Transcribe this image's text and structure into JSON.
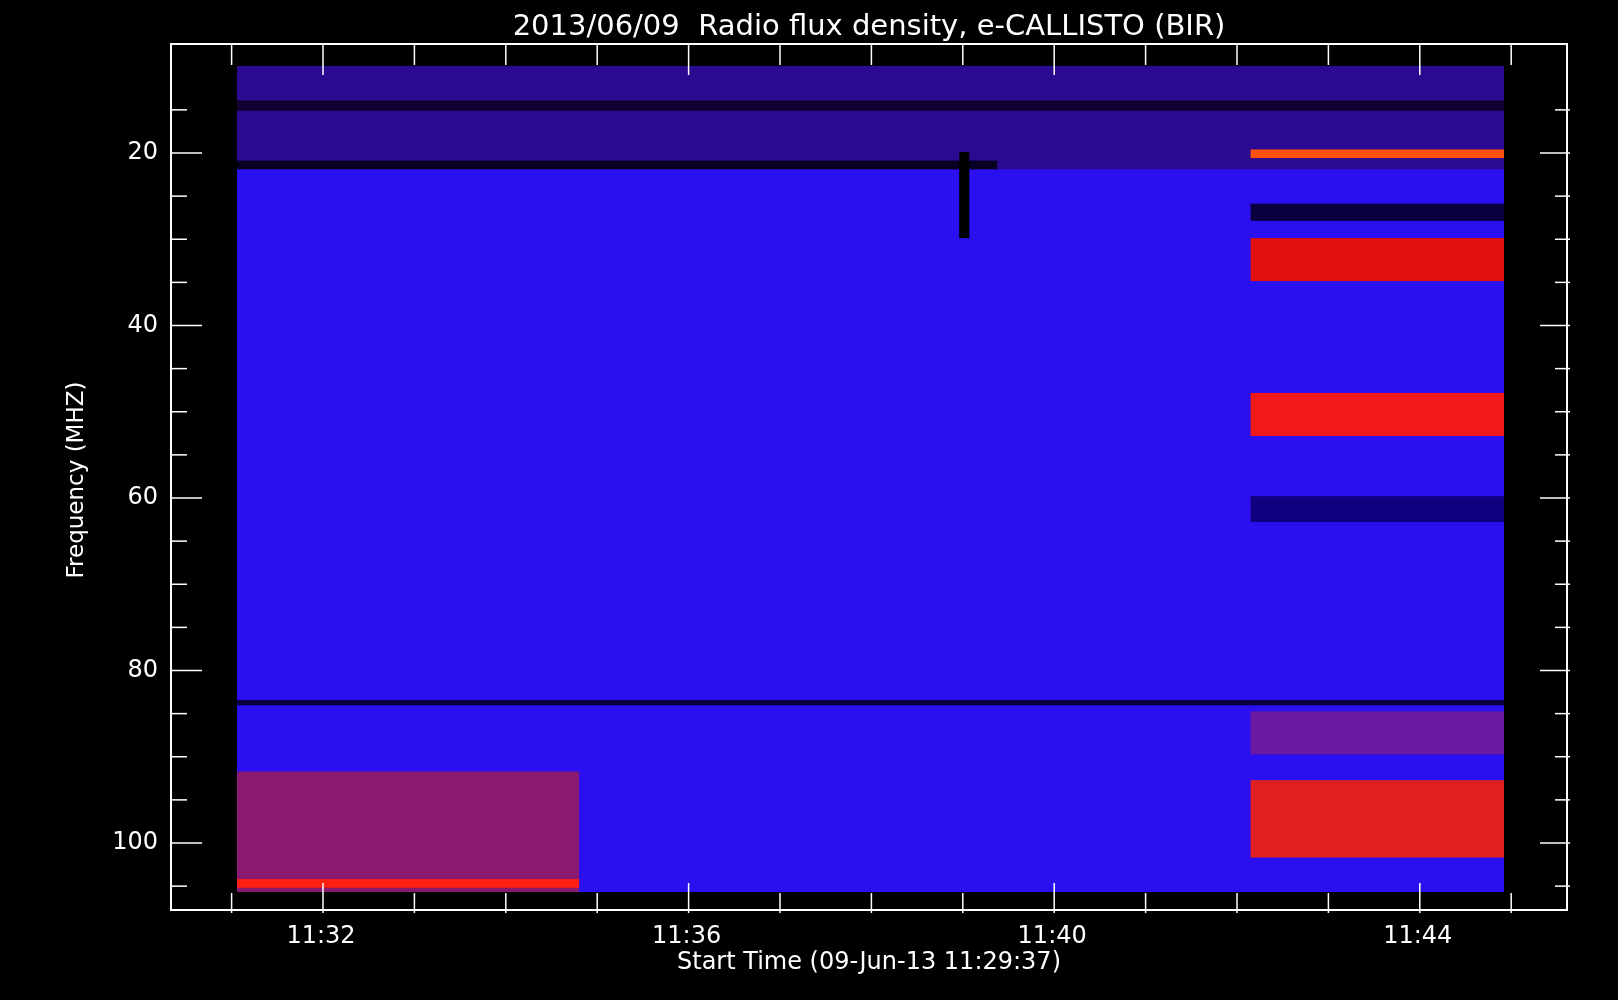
{
  "plot": {
    "title": "2013/06/09  Radio flux density, e-CALLISTO (BIR)",
    "ylabel": "Frequency (MHZ)",
    "xlabel": "Start Time (09-Jun-13 11:29:37)",
    "yticks": [
      "20",
      "40",
      "60",
      "80",
      "100"
    ],
    "xticks": [
      "11:32",
      "11:36",
      "11:40",
      "11:44"
    ]
  }
}
